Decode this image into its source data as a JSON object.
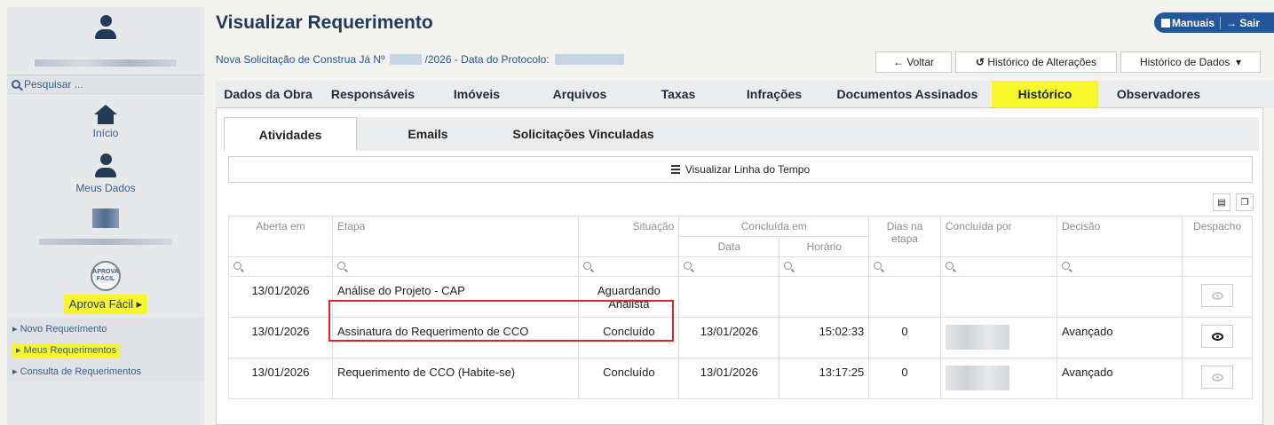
{
  "sidebar": {
    "search_placeholder": "Pesquisar ...",
    "home_label": "Início",
    "my_data_label": "Meus Dados",
    "aprova_logo_text": "APROVA FÁCIL",
    "aprova_label": "Aprova Fácil",
    "aprova_arrow": "▸",
    "submenu": [
      {
        "label": "Novo Requerimento",
        "arrow": "▸"
      },
      {
        "label": "Meus Requerimentos",
        "arrow": "▸"
      },
      {
        "label": "Consulta de Requerimentos",
        "arrow": "▸"
      }
    ]
  },
  "header": {
    "title": "Visualizar Requerimento",
    "manuals_label": "Manuais",
    "exit_label": "Sair",
    "exit_icon": "→",
    "subtitle_prefix": "Nova Solicitação de Construa Já Nº",
    "subtitle_year": "/2026 - Data do Protocolo:"
  },
  "buttons": {
    "back_icon": "←",
    "back": "Voltar",
    "history_icon": "↺",
    "history_changes": "Histórico de Alterações",
    "history_data": "Histórico de Dados",
    "history_data_caret": "▾"
  },
  "tabs": [
    "Dados da Obra",
    "Responsáveis",
    "Imóveis",
    "Arquivos",
    "Taxas",
    "Infrações",
    "Documentos Assinados",
    "Histórico",
    "Observadores"
  ],
  "subtabs": [
    "Atividades",
    "Emails",
    "Solicitações Vinculadas"
  ],
  "timeline_label": "Visualizar Linha do Tempo",
  "table": {
    "headers": {
      "opened": "Aberta em",
      "stage": "Etapa",
      "status": "Situação",
      "completed": "Concluída em",
      "date": "Data",
      "time": "Horário",
      "days": "Dias na etapa",
      "completed_by": "Concluída por",
      "decision": "Decisão",
      "dispatch": "Despacho"
    },
    "rows": [
      {
        "opened": "13/01/2026",
        "stage": "Análise do Projeto - CAP",
        "status": "Aguardando Analista",
        "date": "",
        "time": "",
        "days": "",
        "decision": ""
      },
      {
        "opened": "13/01/2026",
        "stage": "Assinatura do Requerimento de CCO",
        "status": "Concluído",
        "date": "13/01/2026",
        "time": "15:02:33",
        "days": "0",
        "decision": "Avançado"
      },
      {
        "opened": "13/01/2026",
        "stage": "Requerimento de CCO (Habite-se)",
        "status": "Concluído",
        "date": "13/01/2026",
        "time": "13:17:25",
        "days": "0",
        "decision": "Avançado"
      }
    ]
  }
}
